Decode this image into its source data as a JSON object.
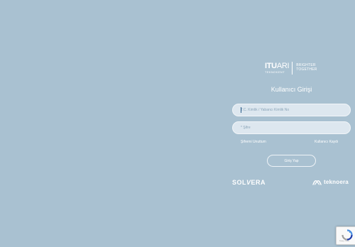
{
  "logo": {
    "brand_bold": "ITU",
    "brand_light": "ARI",
    "sub": "TEKNOKENT",
    "tagline_1": "BRIGHTER",
    "tagline_2": "TOGETHER"
  },
  "login": {
    "title": "Kullanıcı Girişi",
    "id_placeholder": "T.C. Kimlik / Yabancı Kimlik No",
    "password_placeholder": "* Şifre",
    "forgot_label": "Şifremi Unuttum",
    "register_label": "Kullanıcı Kaydı",
    "submit_label": "Giriş Yap"
  },
  "partners": {
    "solvera_pre": "SOL",
    "solvera_v": "V",
    "solvera_post": "ERA",
    "teknoera": "teknoera"
  },
  "recaptcha": {
    "terms": "Privacy - Terms",
    "icon": "recaptcha-icon"
  },
  "colors": {
    "background": "#a9c1d1",
    "field": "#dde7ef",
    "text": "#ffffff"
  }
}
